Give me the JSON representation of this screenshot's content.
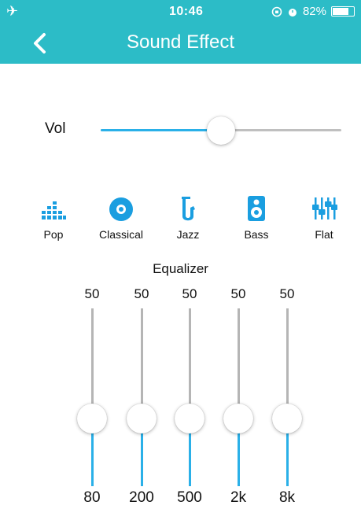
{
  "status_bar": {
    "time": "10:46",
    "battery_text": "82%",
    "battery_level": 0.82,
    "icons": [
      "airplane-icon",
      "lock-rotation-icon",
      "alarm-icon",
      "battery-icon"
    ]
  },
  "header": {
    "title": "Sound Effect",
    "back_icon": "chevron-left-icon"
  },
  "volume": {
    "label": "Vol",
    "level": 0.5
  },
  "presets": [
    {
      "label": "Pop",
      "icon": "bars-icon"
    },
    {
      "label": "Classical",
      "icon": "disc-icon"
    },
    {
      "label": "Jazz",
      "icon": "saxophone-icon"
    },
    {
      "label": "Bass",
      "icon": "speaker-icon"
    },
    {
      "label": "Flat",
      "icon": "sliders-icon"
    }
  ],
  "equalizer": {
    "title": "Equalizer",
    "bands": [
      {
        "freq": "80",
        "value": "50"
      },
      {
        "freq": "200",
        "value": "50"
      },
      {
        "freq": "500",
        "value": "50"
      },
      {
        "freq": "2k",
        "value": "50"
      },
      {
        "freq": "8k",
        "value": "50"
      }
    ]
  },
  "colors": {
    "header": "#2cbcc7",
    "accent": "#2ab0e8",
    "track": "#b5b5b5"
  }
}
